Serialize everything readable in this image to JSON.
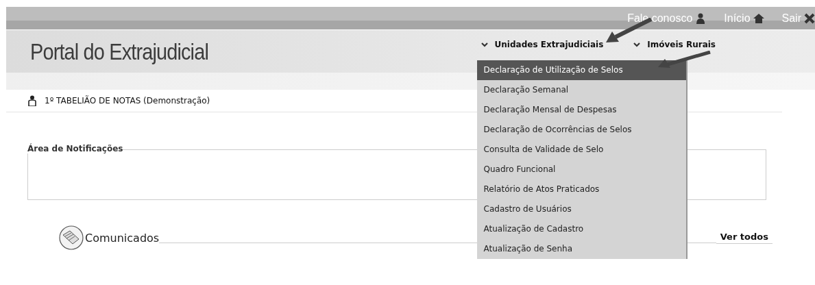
{
  "top_links": [
    {
      "label": "Fale conosco"
    },
    {
      "label": "Início"
    },
    {
      "label": "Sair"
    }
  ],
  "title": "Portal do Extrajudicial",
  "nav": [
    {
      "label": "Unidades Extrajudiciais",
      "children": [
        {
          "label": "Declaração de Utilização de Selos",
          "selected": true
        },
        {
          "label": "Declaração Semanal",
          "selected": false
        },
        {
          "label": "Declaração Mensal de Despesas",
          "selected": false
        },
        {
          "label": "Declaração de Ocorrências de Selos",
          "selected": false
        },
        {
          "label": "Consulta de Validade de Selo",
          "selected": false
        },
        {
          "label": "Quadro Funcional",
          "selected": false
        },
        {
          "label": "Relatório de Atos Praticados",
          "selected": false
        },
        {
          "label": "Cadastro de Usuários",
          "selected": false
        },
        {
          "label": "Atualização de Cadastro",
          "selected": false
        },
        {
          "label": "Atualização de Senha",
          "selected": false
        }
      ]
    },
    {
      "label": "Imóveis Rurais"
    }
  ],
  "user": "1º TABELIÃO DE NOTAS (Demonstração)",
  "notifications": {
    "legend": "Área de Notificações"
  },
  "news": {
    "title": "Comunicados",
    "link": "Ver todos"
  }
}
